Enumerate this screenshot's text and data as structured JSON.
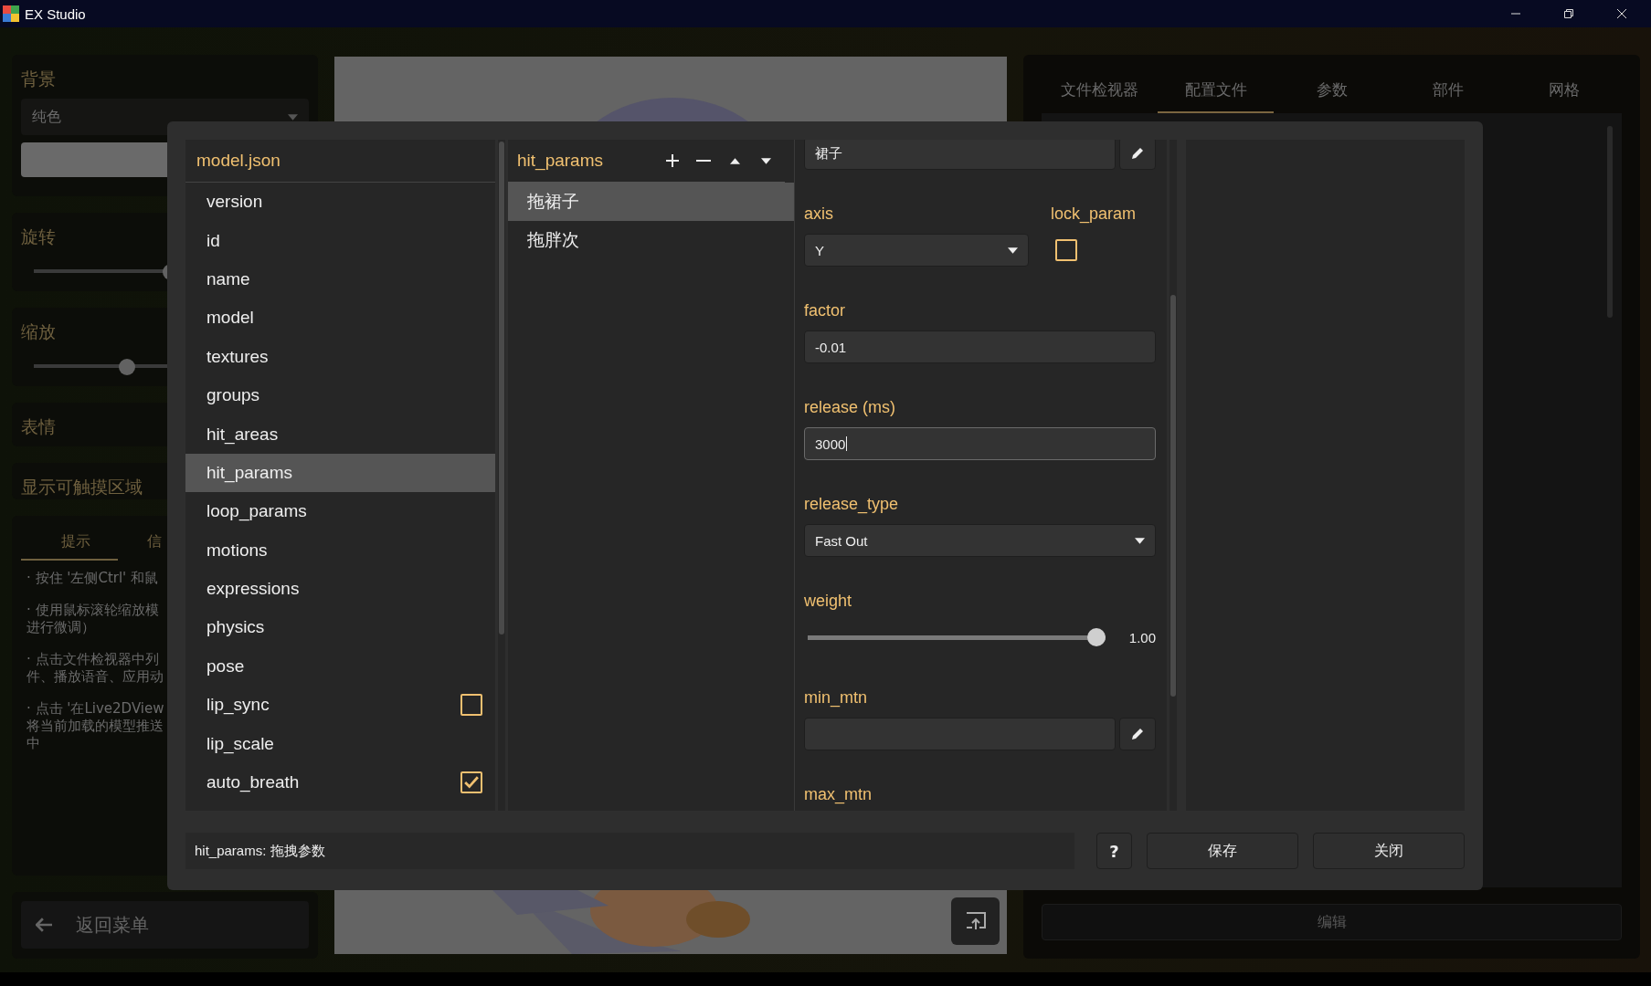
{
  "window": {
    "title": "EX Studio"
  },
  "left_panel": {
    "background": {
      "label": "背景",
      "dropdown": "纯色"
    },
    "rotation": {
      "label": "旋转",
      "level": 0.5
    },
    "scale": {
      "label": "缩放",
      "level": 0.34
    },
    "expressions": {
      "label": "表情"
    },
    "hit_area_toggle": {
      "label": "显示可触摸区域"
    },
    "tabs": [
      {
        "label": "提示",
        "selected": true
      },
      {
        "label": "信",
        "selected": false
      }
    ],
    "tips": [
      [
        "· 按住 '左侧Ctrl' 和鼠"
      ],
      [
        "· 使用鼠标滚轮缩放模",
        "进行微调）"
      ],
      [
        "· 点击文件检视器中列",
        "件、播放语音、应用动"
      ],
      [
        "· 点击 '在Live2DView",
        "将当前加载的模型推送",
        "中"
      ]
    ],
    "back_button": "返回菜单"
  },
  "right_panel": {
    "tabs": [
      {
        "label": "文件检视器",
        "selected": false
      },
      {
        "label": "配置文件",
        "selected": true
      },
      {
        "label": "参数",
        "selected": false
      },
      {
        "label": "部件",
        "selected": false
      },
      {
        "label": "网格",
        "selected": false
      }
    ],
    "edit_button": "编辑"
  },
  "dialog": {
    "file_tree": {
      "title": "model.json",
      "items": [
        {
          "label": "version",
          "kind": "plain",
          "selected": false
        },
        {
          "label": "id",
          "kind": "plain",
          "selected": false
        },
        {
          "label": "name",
          "kind": "plain",
          "selected": false
        },
        {
          "label": "model",
          "kind": "plain",
          "selected": false
        },
        {
          "label": "textures",
          "kind": "plain",
          "selected": false
        },
        {
          "label": "groups",
          "kind": "plain",
          "selected": false
        },
        {
          "label": "hit_areas",
          "kind": "plain",
          "selected": false
        },
        {
          "label": "hit_params",
          "kind": "plain",
          "selected": true
        },
        {
          "label": "loop_params",
          "kind": "plain",
          "selected": false
        },
        {
          "label": "motions",
          "kind": "plain",
          "selected": false
        },
        {
          "label": "expressions",
          "kind": "plain",
          "selected": false
        },
        {
          "label": "physics",
          "kind": "plain",
          "selected": false
        },
        {
          "label": "pose",
          "kind": "plain",
          "selected": false
        },
        {
          "label": "lip_sync",
          "kind": "checkbox",
          "selected": false,
          "checked": false
        },
        {
          "label": "lip_scale",
          "kind": "plain",
          "selected": false
        },
        {
          "label": "auto_breath",
          "kind": "checkbox",
          "selected": false,
          "checked": true
        }
      ]
    },
    "entries": {
      "title": "hit_params",
      "items": [
        {
          "label": "拖裙子",
          "selected": true
        },
        {
          "label": "拖胖次",
          "selected": false
        }
      ]
    },
    "form": {
      "fields": [
        {
          "kind": "text_edit",
          "value": "裙子"
        },
        {
          "kind": "dropdown_check",
          "label": "axis",
          "value": "Y",
          "check_label": "lock_param",
          "checked": false
        },
        {
          "kind": "text",
          "label": "factor",
          "value": "-0.01",
          "focused": false
        },
        {
          "kind": "text",
          "label": "release (ms)",
          "value": "3000",
          "focused": true
        },
        {
          "kind": "dropdown",
          "label": "release_type",
          "value": "Fast Out"
        },
        {
          "kind": "slider",
          "label": "weight",
          "level": 1,
          "reading": "1.00"
        },
        {
          "kind": "text_edit",
          "label": "min_mtn"
        },
        {
          "kind": "label",
          "label": "max_mtn"
        }
      ]
    },
    "status": "hit_params: 拖拽参数",
    "buttons": [
      "?",
      "保存",
      "关闭"
    ]
  }
}
